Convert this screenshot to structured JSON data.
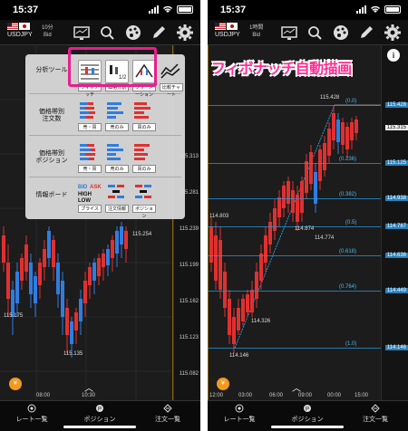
{
  "status_time": "15:37",
  "left": {
    "pair": "USDJPY",
    "period": "10分",
    "bid": "Bid",
    "menu": {
      "rows": [
        {
          "label": "分析ツール",
          "buttons": [
            "フィボナッチ",
            "価格分割",
            "フォーメーション",
            "比較チャート"
          ]
        },
        {
          "label": "価格帯別\n注文数",
          "buttons": [
            "売・買",
            "売のみ",
            "買のみ"
          ]
        },
        {
          "label": "価格帯別\nポジション",
          "buttons": [
            "売・買",
            "売のみ",
            "買のみ"
          ]
        },
        {
          "label": "情報ボード",
          "buttons": [
            "プライス",
            "注文情報",
            "ポジション"
          ]
        }
      ],
      "info_board_icon_text": [
        "BID",
        "ASK",
        "HIGH",
        "LOW"
      ]
    },
    "price_labels": {
      "p1": "115.254",
      "p2": "115.175",
      "p3": "115.135",
      "p4": "115.313",
      "p5": "115.281"
    },
    "x_labels": [
      "08:00",
      "10:30"
    ],
    "y_labels": [
      "115.313",
      "115.281",
      "115.239",
      "115.199",
      "115.162",
      "115.123",
      "115.082"
    ]
  },
  "right": {
    "pair": "USDJPY",
    "period": "1時間",
    "bid": "Bid",
    "banner": "フィボナッチ自動描画",
    "fib_levels": [
      "(0.0)",
      "(0.236)",
      "(0.382)",
      "(0.5)",
      "(0.618)",
      "(0.764)",
      "(1.0)"
    ],
    "fib_prices": [
      "115.428",
      "115.125",
      "114.938",
      "114.787",
      "114.636",
      "114.449",
      "114.146"
    ],
    "current_price": "115.315",
    "price_labels": {
      "high": "115.428",
      "a": "114.803",
      "b": "114.874",
      "c": "114.774",
      "d": "114.326",
      "low": "114.146"
    },
    "x_labels": [
      "12:00",
      "03:00",
      "06:00",
      "09:00",
      "00:00",
      "15:00"
    ]
  },
  "nav": {
    "rate": "レート一覧",
    "position": "ポジション",
    "order": "注文一覧"
  },
  "info_icon": "i",
  "yen_icon": "¥"
}
